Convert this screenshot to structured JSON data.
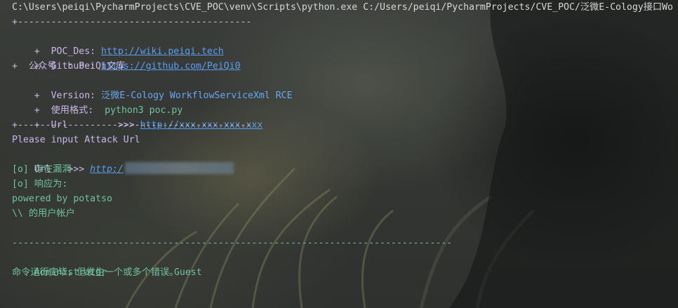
{
  "command_line": "C:\\Users\\peiqi\\PycharmProjects\\CVE_POC\\venv\\Scripts\\python.exe C:/Users/peiqi/PycharmProjects/CVE_POC/泛微E-Cology接口Wo",
  "banner": {
    "border": "+------------------------------------------",
    "poc_des_label": "+  POC_Des: ",
    "poc_des_link": "http://wiki.peiqi.tech",
    "github_label": "+  Github : ",
    "github_link": "https://github.com/PeiQi0",
    "wechat_line": "+  公众号  : PeiQi文库",
    "version_label": "+  Version: ",
    "version_value": "泛微E-Cology WorkflowServiceXml RCE",
    "usage_label": "+  使用格式:  ",
    "usage_value": "python3 poc.py",
    "url_label": "+  Url         >>> ",
    "url_link": "http://xxx.xxx.xxx.xxx"
  },
  "output": {
    "prompt": "Please input Attack Url",
    "url_prefix": "Url   >>> ",
    "url_value": "http:/",
    "vuln_line": "[o] 存在漏洞",
    "response_line": "[o] 响应为:",
    "powered_line": "powered by potatso",
    "user_accounts_line": "\\\\ 的用户帐户",
    "separator": "-------------------------------------------------------------------------------",
    "account1": "Administrator",
    "account2": "Guest",
    "result_line": "命令运行完毕，但发生一个或多个错误。"
  }
}
